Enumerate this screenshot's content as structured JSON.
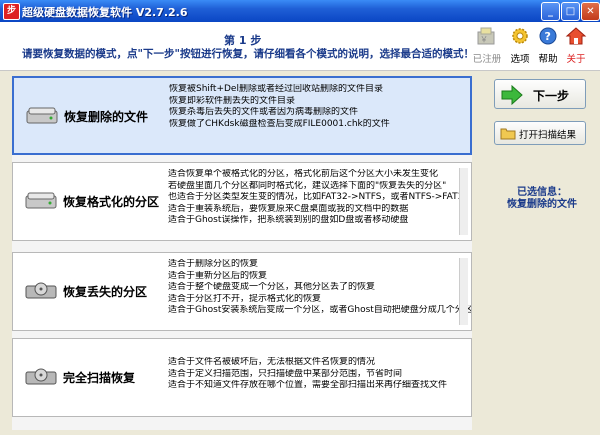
{
  "window": {
    "title": "超级硬盘数据恢复软件 V2.7.2.6",
    "icon_text": "步",
    "minimize_glyph": "_",
    "maximize_glyph": "□",
    "close_glyph": "✕"
  },
  "header": {
    "step": "第 1 步",
    "instruction": "请要恢复数据的模式，点\"下一步\"按钮进行恢复，请仔细看各个模式的说明，选择最合适的模式！"
  },
  "toolbar": [
    {
      "label": "已注册",
      "icon": "register-icon",
      "enabled": false
    },
    {
      "label": "选项",
      "icon": "gear-icon",
      "enabled": true
    },
    {
      "label": "帮助",
      "icon": "help-icon",
      "enabled": true
    },
    {
      "label": "关于",
      "icon": "home-icon",
      "enabled": true
    }
  ],
  "modes": [
    {
      "label": "恢复删除的文件",
      "selected": true,
      "descs": [
        "恢复被Shift+Del删除或者经过回收站删除的文件目录",
        "恢复即彩软件删丢失的文件目录",
        "恢复杀毒后丢失的文件或者因为病毒删除的文件",
        "恢复做了CHKdsk磁盘检查后变成FILE0001.chk的文件"
      ]
    },
    {
      "label": "恢复格式化的分区",
      "selected": false,
      "descs": [
        "适合恢复单个被格式化的分区，格式化前后这个分区大小未发生变化",
        "若硬盘里面几个分区都同时格式化，建议选择下面的\"恢复丢失的分区\"",
        "也适合于分区类型发生变的情况，比如FAT32->NTFS，或者NTFS->FAT3",
        "适合于重装系统后，要恢复原来C盘桌面或我的文档中的数据",
        "适合于Ghost误操作，把系统装到别的盘如D盘或者移动硬盘"
      ]
    },
    {
      "label": "恢复丢失的分区",
      "selected": false,
      "descs": [
        "适合于删除分区的恢复",
        "适合于重新分区后的恢复",
        "适合于整个硬盘变成一个分区，其他分区丢了的恢复",
        "适合于分区打不开，提示格式化的恢复",
        "适合于Ghost安装系统后变成一个分区，或者Ghost自动把硬盘分成几个分区"
      ]
    },
    {
      "label": "完全扫描恢复",
      "selected": false,
      "descs": [
        "适合于文件名被破坏后，无法根据文件名恢复的情况",
        "适合于定义扫描范围，只扫描硬盘中某部分范围，节省时间",
        "适合于不知道文件存放在哪个位置，需要全部扫描出来再仔细查找文件"
      ]
    }
  ],
  "side": {
    "next_label": "下一步",
    "open_scan_label": "打开扫描结果",
    "selected_info_title": "已选信息：",
    "selected_info_value": "恢复删除的文件"
  },
  "colors": {
    "titlebar": "#0a46c4",
    "selected_bg": "#dbe8fa",
    "selected_border": "#3a6ed0",
    "info_text": "#1a3a8a"
  }
}
